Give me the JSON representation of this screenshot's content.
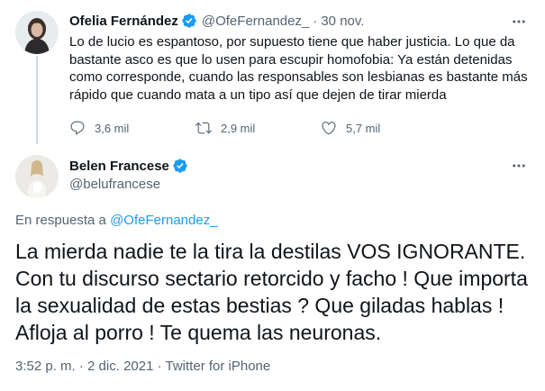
{
  "parent_tweet": {
    "author_name": "Ofelia Fernández",
    "author_handle": "@OfeFernandez_",
    "separator": "·",
    "date": "30 nov.",
    "text": "Lo de lucio es espantoso, por supuesto tiene que haber justicia. Lo que da bastante asco es que lo usen para escupir homofobia: Ya están detenidas como corresponde, cuando las responsables son lesbianas es bastante más rápido que cuando mata a un tipo así que dejen de tirar mierda",
    "replies": "3,6 mil",
    "retweets": "2,9 mil",
    "likes": "5,7 mil"
  },
  "main_tweet": {
    "author_name": "Belen Francese",
    "author_handle": "@belufrancese",
    "in_reply_prefix": "En respuesta a",
    "in_reply_handle": "@OfeFernandez_",
    "text": "La mierda nadie te la tira la destilas  VOS IGNORANTE. Con tu discurso sectario retorcido y facho ! Que importa la sexualidad de estas bestias ? Que giladas hablas ! Afloja al porro ! Te quema las neuronas.",
    "time": "3:52 p. m.",
    "separator": "·",
    "date": "2 dic. 2021",
    "source": "Twitter for iPhone"
  },
  "colors": {
    "text_primary": "#0f1419",
    "text_secondary": "#536471",
    "accent": "#1d9bf0",
    "thread_line": "#cfd9de"
  },
  "icons": [
    "verified-badge-icon",
    "more-options-icon",
    "reply-icon",
    "retweet-icon",
    "like-icon"
  ]
}
